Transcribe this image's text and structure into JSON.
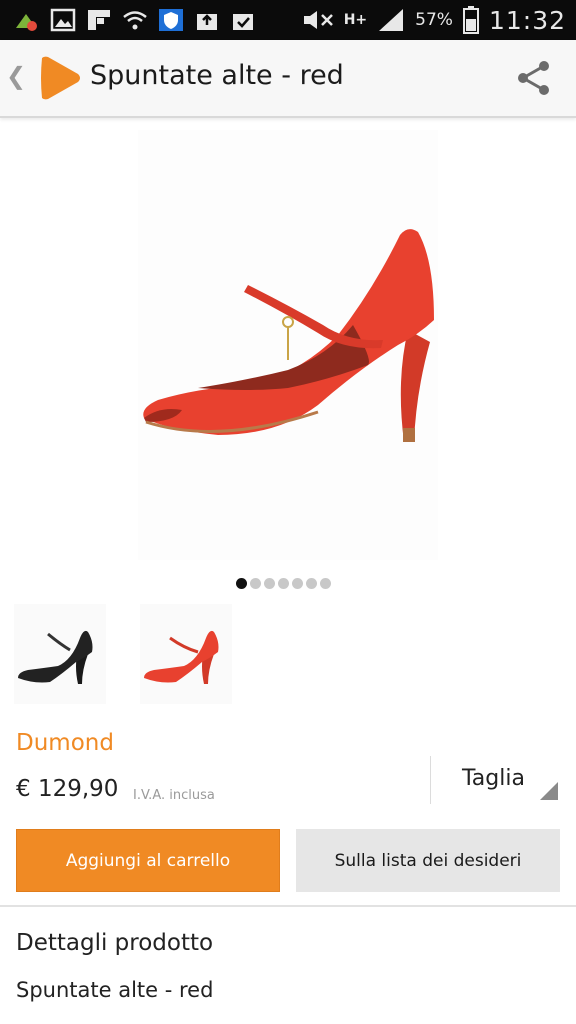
{
  "status_bar": {
    "battery_percent": "57%",
    "time": "11:32",
    "network": "H+"
  },
  "appbar": {
    "back_icon": "chevron-left-icon",
    "logo_icon": "zalando-logo",
    "title": "Spuntate alte - red",
    "share_icon": "share-icon"
  },
  "gallery": {
    "image_count": 7,
    "active_index": 0
  },
  "product": {
    "brand": "Dumond",
    "price": "€ 129,90",
    "vat_note": "I.V.A. inclusa",
    "size_label": "Taglia"
  },
  "actions": {
    "add_to_cart": "Aggiungi al carrello",
    "wishlist": "Sulla lista dei desideri"
  },
  "details": {
    "heading": "Dettagli prodotto",
    "name": "Spuntate alte - red"
  },
  "colors": {
    "accent": "#f08a24",
    "shoe_red": "#e8412f"
  }
}
